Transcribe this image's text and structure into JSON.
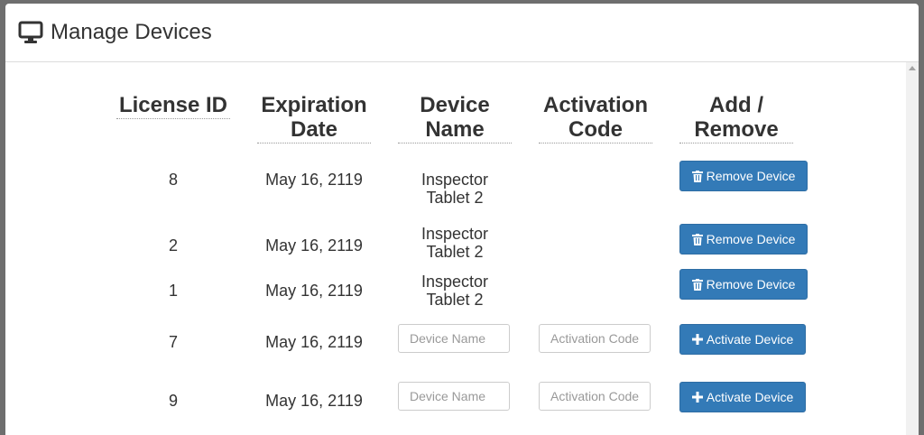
{
  "panel": {
    "title": "Manage Devices",
    "icon": "monitor-icon"
  },
  "table": {
    "headers": [
      "License ID",
      "Expiration Date",
      "Device Name",
      "Activation Code",
      "Add / Remove"
    ],
    "rows": [
      {
        "license_id": "8",
        "expiration": "May 16, 2119",
        "device_name": "Inspector Tablet 2",
        "action": "Remove Device",
        "action_icon": "trash-icon"
      },
      {
        "license_id": "2",
        "expiration": "May 16, 2119",
        "device_name": "Inspector Tablet 2",
        "action": "Remove Device",
        "action_icon": "trash-icon"
      },
      {
        "license_id": "1",
        "expiration": "May 16, 2119",
        "device_name": "Inspector Tablet 2",
        "action": "Remove Device",
        "action_icon": "trash-icon"
      },
      {
        "license_id": "7",
        "expiration": "May 16, 2119",
        "device_name_placeholder": "Device Name",
        "activation_placeholder": "Activation Code",
        "action": "Activate Device",
        "action_icon": "plus-icon"
      },
      {
        "license_id": "9",
        "expiration": "May 16, 2119",
        "device_name_placeholder": "Device Name",
        "activation_placeholder": "Activation Code",
        "action": "Activate Device",
        "action_icon": "plus-icon"
      }
    ]
  },
  "colors": {
    "primary_button": "#337ab7",
    "header_text": "#333333"
  }
}
